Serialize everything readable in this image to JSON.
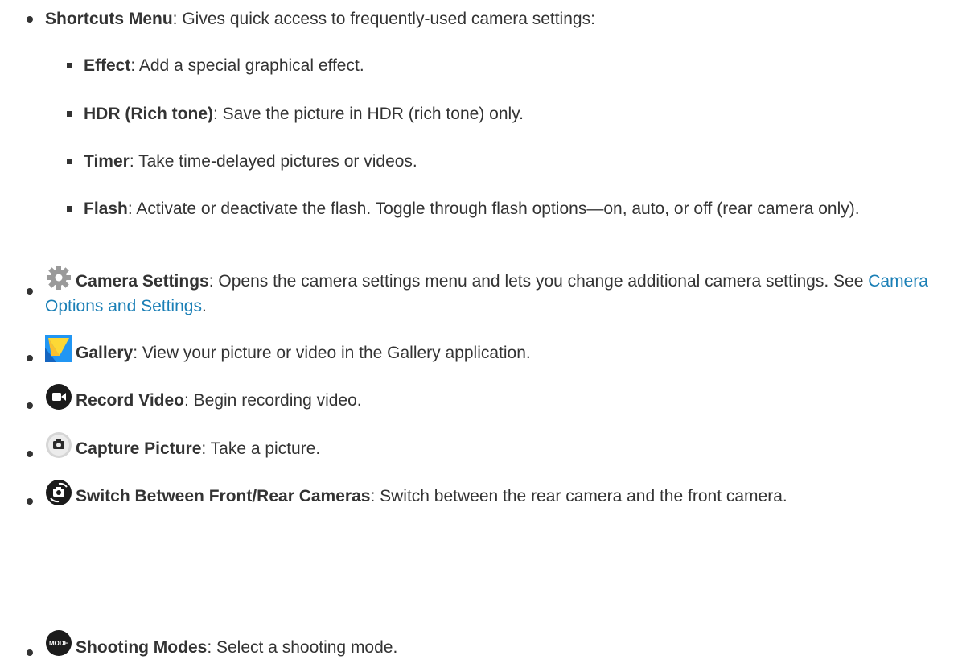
{
  "items": [
    {
      "term": "Shortcuts Menu",
      "desc": ": Gives quick access to frequently-used camera settings:"
    },
    {
      "term": "Effect",
      "desc": ": Add a special graphical effect."
    },
    {
      "term": "HDR (Rich tone)",
      "desc": ": Save the picture in HDR (rich tone) only."
    },
    {
      "term": "Timer",
      "desc": ": Take time-delayed pictures or videos."
    },
    {
      "term": "Flash",
      "desc": ": Activate or deactivate the flash. Toggle through flash options—on, auto, or off (rear camera only)."
    },
    {
      "term": "Camera Settings",
      "desc": ": Opens the camera settings menu and lets you change additional camera settings. See ",
      "link": "Camera Options and Settings",
      "after": "."
    },
    {
      "term": "Gallery",
      "desc": ": View your picture or video in the Gallery application."
    },
    {
      "term": "Record Video",
      "desc": ": Begin recording video."
    },
    {
      "term": "Capture Picture",
      "desc": ": Take a picture."
    },
    {
      "term": "Switch Between Front/Rear Cameras",
      "desc": ": Switch between the rear camera and the front camera."
    },
    {
      "term": "Shooting Modes",
      "desc": ": Select a shooting mode.",
      "icon_text": "MODE"
    }
  ],
  "icons": [
    "gear-icon",
    "gallery-icon",
    "record-video-icon",
    "capture-picture-icon",
    "switch-camera-icon",
    "mode-icon"
  ],
  "colors": {
    "text": "#333333",
    "link": "#1a7fb6"
  }
}
